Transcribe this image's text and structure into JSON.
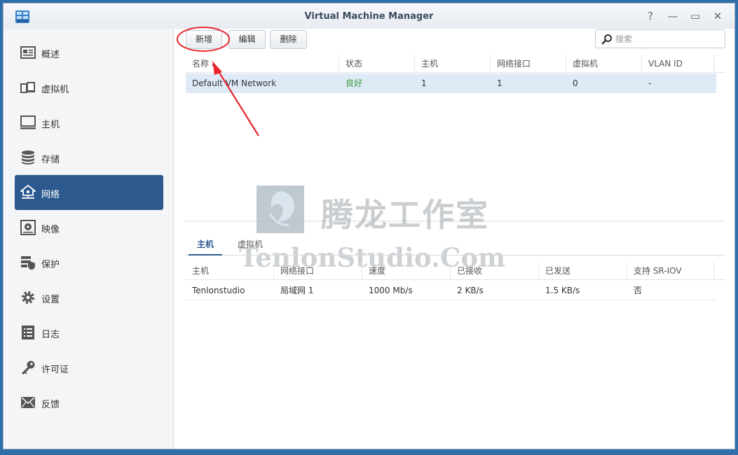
{
  "app": {
    "title": "Virtual Machine Manager",
    "accent_color": "#2c5a8e",
    "window_controls": [
      {
        "name": "help",
        "glyph": "?"
      },
      {
        "name": "minimize",
        "glyph": "—"
      },
      {
        "name": "maximize",
        "glyph": "▭"
      },
      {
        "name": "close",
        "glyph": "✕"
      }
    ]
  },
  "sidebar": {
    "items": [
      {
        "key": "overview",
        "label": "概述",
        "icon": "overview-icon"
      },
      {
        "key": "virtual-machine",
        "label": "虚拟机",
        "icon": "virtual-machine-icon"
      },
      {
        "key": "host",
        "label": "主机",
        "icon": "monitor-icon"
      },
      {
        "key": "storage",
        "label": "存储",
        "icon": "database-icon"
      },
      {
        "key": "network",
        "label": "网络",
        "icon": "network-icon",
        "active": true
      },
      {
        "key": "image",
        "label": "映像",
        "icon": "disc-icon"
      },
      {
        "key": "protection",
        "label": "保护",
        "icon": "shield-server-icon"
      },
      {
        "key": "settings",
        "label": "设置",
        "icon": "gear-icon"
      },
      {
        "key": "log",
        "label": "日志",
        "icon": "log-list-icon"
      },
      {
        "key": "license",
        "label": "许可证",
        "icon": "key-icon"
      },
      {
        "key": "feedback",
        "label": "反馈",
        "icon": "envelope-icon"
      }
    ]
  },
  "toolbar": {
    "add_label": "新增",
    "edit_label": "编辑",
    "delete_label": "删除",
    "search_placeholder": "搜索"
  },
  "network_table": {
    "columns": [
      "名称",
      "状态",
      "主机",
      "网络接口",
      "虚拟机",
      "VLAN ID"
    ],
    "rows": [
      {
        "name": "Default VM Network",
        "status": "良好",
        "hosts": "1",
        "interfaces": "1",
        "vms": "0",
        "vlan": "-"
      }
    ]
  },
  "detail": {
    "tabs": [
      "主机",
      "虚拟机"
    ],
    "columns": [
      "主机",
      "网络接口",
      "速度",
      "已接收",
      "已发送",
      "支持 SR-IOV"
    ],
    "rows": [
      {
        "host": "Tenlonstudio",
        "interface": "局域网 1",
        "speed": "1000 Mb/s",
        "received": "2 KB/s",
        "sent": "1.5 KB/s",
        "sriov": "否"
      }
    ]
  },
  "watermark": {
    "title": "腾龙工作室",
    "subtitle": "TenlonStudio.Com"
  },
  "annotation": {
    "color": "#e8262c"
  }
}
